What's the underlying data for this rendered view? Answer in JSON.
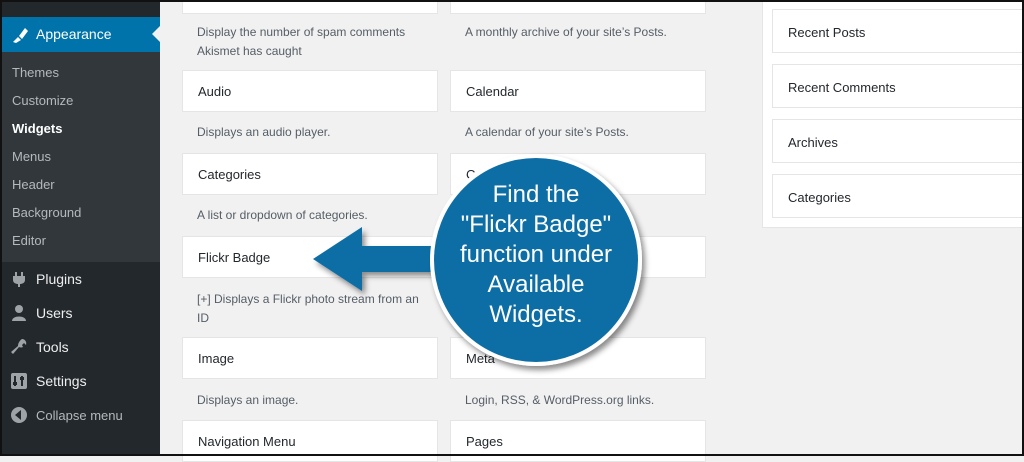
{
  "sidebar": {
    "active_menu": "Appearance",
    "submenu": [
      "Themes",
      "Customize",
      "Widgets",
      "Menus",
      "Header",
      "Background",
      "Editor"
    ],
    "current_submenu": "Widgets",
    "menu": [
      {
        "label": "Plugins",
        "icon": "plugin-icon"
      },
      {
        "label": "Users",
        "icon": "users-icon"
      },
      {
        "label": "Tools",
        "icon": "tools-icon"
      },
      {
        "label": "Settings",
        "icon": "settings-icon"
      }
    ],
    "collapse_label": "Collapse menu"
  },
  "widgets": {
    "left_column": {
      "top_desc": "Display the number of spam comments Akismet has caught",
      "items": [
        {
          "title": "Audio",
          "desc": "Displays an audio player."
        },
        {
          "title": "Categories",
          "desc": "A list or dropdown of categories."
        },
        {
          "title": "Flickr Badge",
          "desc": "[+] Displays a Flickr photo stream from an ID"
        },
        {
          "title": "Image",
          "desc": "Displays an image."
        },
        {
          "title": "Navigation Menu",
          "desc": ""
        }
      ]
    },
    "middle_column": {
      "top_desc": "A monthly archive of your site’s Posts.",
      "items": [
        {
          "title": "Calendar",
          "desc": "A calendar of your site’s Posts."
        },
        {
          "title": "C",
          "desc": ""
        },
        {
          "title": "",
          "desc": ""
        },
        {
          "title": "Meta",
          "desc": "Login, RSS, & WordPress.org links."
        },
        {
          "title": "Pages",
          "desc": ""
        }
      ]
    }
  },
  "sidebar_widgets": [
    "Recent Posts",
    "Recent Comments",
    "Archives",
    "Categories"
  ],
  "callout": {
    "lines": [
      "Find the",
      "\"Flickr Badge\"",
      "function under",
      "Available",
      "Widgets."
    ],
    "color": "#0f6ea6"
  },
  "colors": {
    "admin_bg": "#23282d",
    "accent": "#0073aa",
    "page_bg": "#f1f1f1"
  }
}
